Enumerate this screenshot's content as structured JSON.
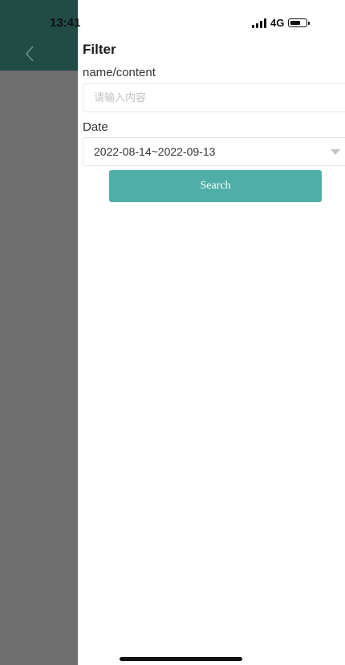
{
  "status_bar": {
    "time": "13:41",
    "network": "4G",
    "signal_icon": "signal-bars-icon",
    "battery_icon": "battery-icon"
  },
  "background": {
    "back_icon": "chevron-left-icon",
    "header_color": "#214b45",
    "overlay_color": "#6e6e6e"
  },
  "filter": {
    "title": "Filter",
    "name_label": "name/content",
    "name_value": "",
    "name_placeholder": "请输入内容",
    "date_label": "Date",
    "date_value": "2022-08-14~2022-09-13",
    "dropdown_icon": "caret-down-icon",
    "search_label": "Search",
    "accent_color": "#4fafa8"
  }
}
